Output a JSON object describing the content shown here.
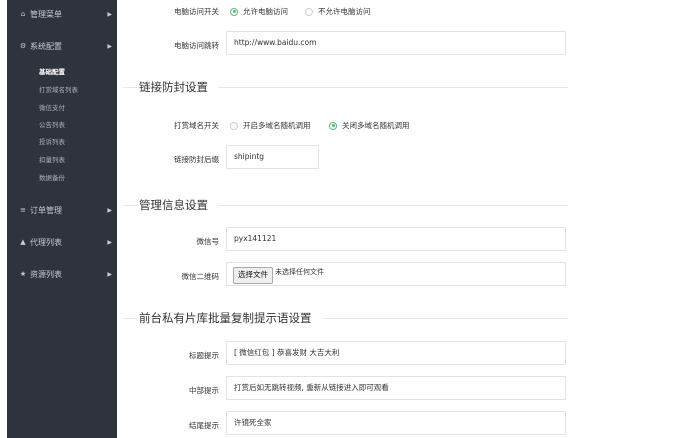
{
  "sidebar": {
    "items": [
      {
        "icon": "home-icon",
        "glyph": "⌂",
        "label": "管理菜单"
      },
      {
        "icon": "gear-icon",
        "glyph": "⚙",
        "label": "系统配置"
      },
      {
        "icon": "chart-icon",
        "glyph": "≡",
        "label": "订单管理"
      },
      {
        "icon": "user-icon",
        "glyph": "▲",
        "label": "代理列表"
      },
      {
        "icon": "star-icon",
        "glyph": "★",
        "label": "资源列表"
      }
    ],
    "arrow_glyph": "▶",
    "subitems": [
      "基础配置",
      "打赏域名列表",
      "微信支付",
      "公告列表",
      "投诉列表",
      "扣量列表",
      "数据备份"
    ]
  },
  "main": {
    "pc_access": {
      "label": "电脑访问开关",
      "options": [
        {
          "label": "允许电脑访问",
          "checked": true
        },
        {
          "label": "不允许电脑访问",
          "checked": false
        }
      ]
    },
    "pc_redirect": {
      "label": "电脑访问跳转",
      "value": "http://www.baidu.com"
    },
    "section_anti_block": "链接防封设置",
    "reward_domain": {
      "label": "打赏域名开关",
      "options": [
        {
          "label": "开启多域名随机调用",
          "checked": false
        },
        {
          "label": "关闭多域名随机调用",
          "checked": true
        }
      ]
    },
    "link_suffix": {
      "label": "链接防封后缀",
      "value": "shipintg"
    },
    "section_admin": "管理信息设置",
    "wechat_id": {
      "label": "微信号",
      "value": "pyx141121"
    },
    "wechat_qr": {
      "label": "微信二维码",
      "button": "选择文件",
      "status": "未选择任何文件"
    },
    "section_prompt": "前台私有片库批量复制提示语设置",
    "title_prompt": {
      "label": "标题提示",
      "value": "[ 微信红包 ] 恭喜发财 大吉大利"
    },
    "middle_prompt": {
      "label": "中部提示",
      "value": "打赏后如无跳转视频, 重新从链接进入即可观看"
    },
    "end_prompt": {
      "label": "结尾提示",
      "value": "许镜死全家"
    }
  },
  "colors": {
    "sidebar_bg": "#2f333e",
    "radio_active": "#5fb878"
  }
}
